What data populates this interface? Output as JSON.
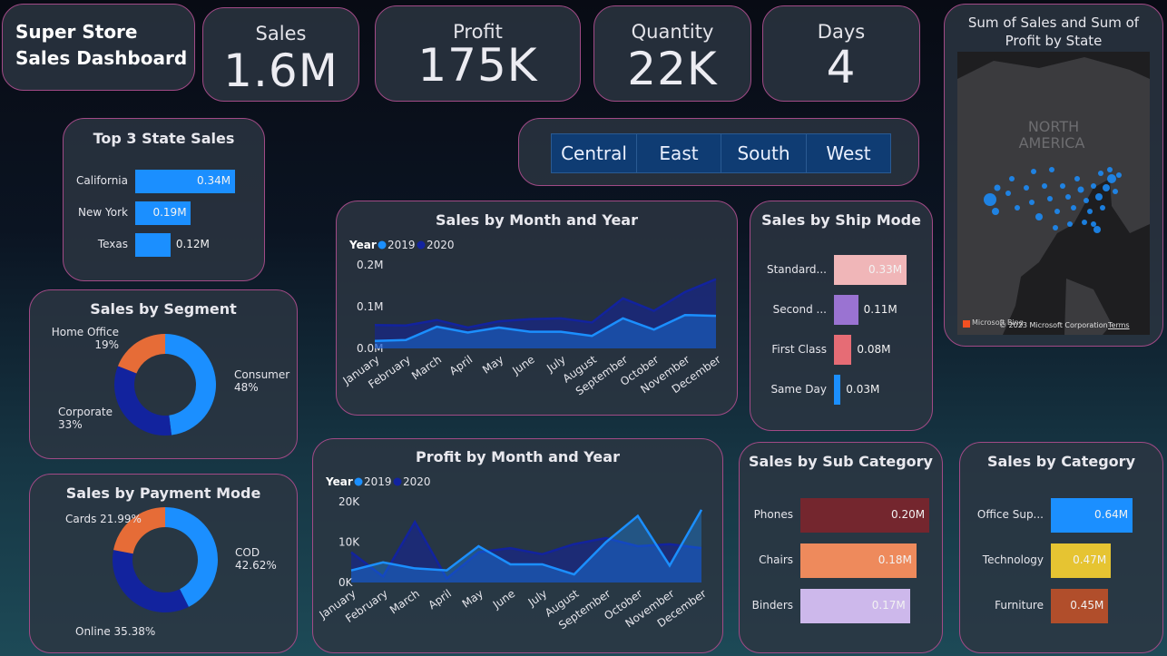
{
  "dashboard_title": "Super Store Sales Dashboard",
  "kpis": [
    {
      "label": "Sales",
      "value": "1.6M"
    },
    {
      "label": "Profit",
      "value": "175K"
    },
    {
      "label": "Quantity",
      "value": "22K"
    },
    {
      "label": "Days",
      "value": "4"
    }
  ],
  "region_slicer": [
    "Central",
    "East",
    "South",
    "West"
  ],
  "map": {
    "title": "Sum of Sales and Sum of Profit by State",
    "continent_label": "NORTH AMERICA",
    "attribution": "© 2023 Microsoft Corporation",
    "terms": "Terms",
    "brand": "Microsoft Bing"
  },
  "colors": {
    "series_2019": "#1b8fff",
    "series_2020": "#12239e"
  },
  "chart_data": [
    {
      "id": "top3",
      "type": "bar",
      "title": "Top 3 State Sales",
      "categories": [
        "California",
        "New York",
        "Texas"
      ],
      "values": [
        0.34,
        0.19,
        0.12
      ],
      "labels": [
        "0.34M",
        "0.19M",
        "0.12M"
      ],
      "color": "#1b8fff"
    },
    {
      "id": "segment",
      "type": "pie",
      "title": "Sales by Segment",
      "slices": [
        {
          "name": "Consumer",
          "pct": "48%",
          "value": 48,
          "color": "#1b8fff"
        },
        {
          "name": "Corporate",
          "pct": "33%",
          "value": 33,
          "color": "#12239e"
        },
        {
          "name": "Home Office",
          "pct": "19%",
          "value": 19,
          "color": "#e66c37"
        }
      ]
    },
    {
      "id": "payment",
      "type": "pie",
      "title": "Sales by Payment Mode",
      "slices": [
        {
          "name": "COD",
          "pct": "42.62%",
          "value": 42.62,
          "color": "#1b8fff"
        },
        {
          "name": "Online",
          "pct": "35.38%",
          "value": 35.38,
          "color": "#12239e"
        },
        {
          "name": "Cards",
          "pct": "21.99%",
          "value": 21.99,
          "color": "#e66c37"
        }
      ]
    },
    {
      "id": "sales_month",
      "type": "area",
      "title": "Sales by Month and Year",
      "legend_title": "Year",
      "categories": [
        "January",
        "February",
        "March",
        "April",
        "May",
        "June",
        "July",
        "August",
        "September",
        "October",
        "November",
        "December"
      ],
      "yticks": [
        "0.0M",
        "0.1M",
        "0.2M"
      ],
      "ylim": [
        0,
        0.2
      ],
      "series": [
        {
          "name": "2019",
          "values": [
            0.018,
            0.02,
            0.052,
            0.038,
            0.05,
            0.04,
            0.04,
            0.03,
            0.072,
            0.045,
            0.08,
            0.078
          ]
        },
        {
          "name": "2020",
          "values": [
            0.056,
            0.055,
            0.068,
            0.05,
            0.065,
            0.07,
            0.072,
            0.062,
            0.12,
            0.09,
            0.135,
            0.166
          ]
        }
      ]
    },
    {
      "id": "profit_month",
      "type": "area",
      "title": "Profit by Month and Year",
      "legend_title": "Year",
      "categories": [
        "January",
        "February",
        "March",
        "April",
        "May",
        "June",
        "July",
        "August",
        "September",
        "October",
        "November",
        "December"
      ],
      "yticks": [
        "0K",
        "10K",
        "20K"
      ],
      "ylim": [
        0,
        20000
      ],
      "series": [
        {
          "name": "2019",
          "values": [
            3000,
            5000,
            3500,
            3000,
            9000,
            4500,
            4500,
            2000,
            10000,
            16500,
            4200,
            18000
          ]
        },
        {
          "name": "2020",
          "values": [
            7500,
            1500,
            15000,
            1000,
            7500,
            8500,
            7000,
            9500,
            11000,
            9000,
            9500,
            8500
          ]
        }
      ]
    },
    {
      "id": "shipmode",
      "type": "bar",
      "title": "Sales by Ship Mode",
      "categories": [
        "Standard...",
        "Second ...",
        "First Class",
        "Same Day"
      ],
      "values": [
        0.33,
        0.11,
        0.08,
        0.03
      ],
      "labels": [
        "0.33M",
        "0.11M",
        "0.08M",
        "0.03M"
      ],
      "colors": [
        "#f0b6b8",
        "#9a73d2",
        "#e66c75",
        "#1b8fff"
      ]
    },
    {
      "id": "subcat",
      "type": "bar",
      "title": "Sales by Sub Category",
      "categories": [
        "Phones",
        "Chairs",
        "Binders"
      ],
      "values": [
        0.2,
        0.18,
        0.17
      ],
      "labels": [
        "0.20M",
        "0.18M",
        "0.17M"
      ],
      "colors": [
        "#74262e",
        "#ee8a5c",
        "#cdb8eb"
      ]
    },
    {
      "id": "category",
      "type": "bar",
      "title": "Sales by Category",
      "categories": [
        "Office Sup...",
        "Technology",
        "Furniture"
      ],
      "values": [
        0.64,
        0.47,
        0.45
      ],
      "labels": [
        "0.64M",
        "0.47M",
        "0.45M"
      ],
      "colors": [
        "#1b8fff",
        "#e6c432",
        "#b14e2b"
      ]
    }
  ]
}
